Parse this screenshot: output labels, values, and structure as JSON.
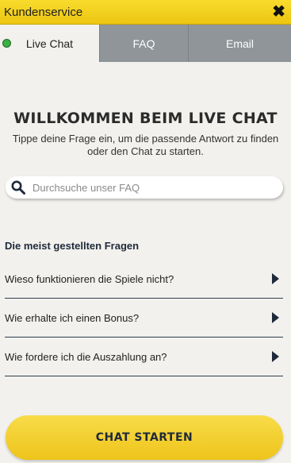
{
  "header": {
    "title": "Kundenservice",
    "close_icon": "close-icon",
    "close_glyph": "✖"
  },
  "tabs": [
    {
      "label": "Live Chat",
      "active": true,
      "status": "online"
    },
    {
      "label": "FAQ",
      "active": false
    },
    {
      "label": "Email",
      "active": false
    }
  ],
  "welcome": {
    "heading": "WILLKOMMEN BEIM LIVE CHAT",
    "subtext": "Tippe deine Frage ein, um die passende Antwort zu finden oder den Chat zu starten."
  },
  "search": {
    "placeholder": "Durchsuche unser FAQ",
    "value": "",
    "icon": "search-icon"
  },
  "faq": {
    "heading": "Die meist gestellten Fragen",
    "items": [
      {
        "question": "Wieso funktionieren die Spiele nicht?"
      },
      {
        "question": "Wie erhalte ich einen Bonus?"
      },
      {
        "question": "Wie fordere ich die Auszahlung an?"
      }
    ]
  },
  "cta": {
    "label": "CHAT STARTEN"
  },
  "colors": {
    "brand_yellow": "#f5d022",
    "tab_inactive": "#8f9598",
    "online_green": "#3cb043",
    "navy": "#1e2a3a",
    "background": "#f2f1ed"
  }
}
